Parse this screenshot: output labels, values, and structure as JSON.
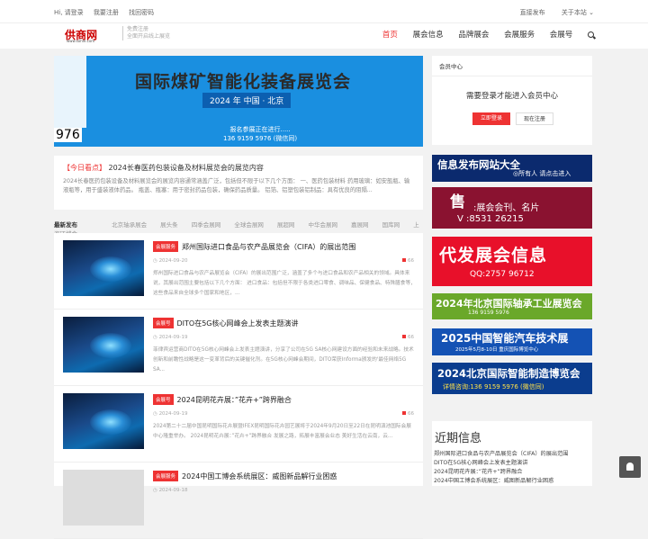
{
  "topbar": {
    "login": "Hi, 请登录",
    "register": "我要注册",
    "forgot": "找回密码",
    "publish": "直接发布",
    "about": "关于本站 ⌄"
  },
  "header": {
    "logo_text": "供商网",
    "logo_url_text": "www.sohle.com",
    "slogan1": "免费注册",
    "slogan2": "全面开启线上展览",
    "nav": [
      "首页",
      "展会信息",
      "品牌展会",
      "会展服务",
      "会展号"
    ]
  },
  "banner": {
    "title": "国际煤矿智能化装备展览会",
    "sub": "2024 年   中国 · 北京",
    "contact1": "报名参展正在进行.....",
    "contact2": "136 9159 5976 (微信同)",
    "corner": "976"
  },
  "today": {
    "tag": "【今日看点】",
    "title": "2024长春医药包装设备及材料展览会的展览内容",
    "desc": "2024长春医药包装设备及材料展览会的展览内容通常涵盖广泛，包括但不限于以下几个方面： 一、医药包装材料 药用玻璃：如安瓿瓶、输液瓶等，用于盛装液体药品。 瓶盖、瓶塞：用于密封药品包装，确保药品质量。 铝箔、铝塑包装铝制品：具有优良的阻隔..."
  },
  "tabs": [
    "最新发布",
    "北京轴承展会",
    "展头条",
    "四季会展网",
    "全球会展网",
    "展超网",
    "中华会展网",
    "嘉展网",
    "国库网",
    "上海环博会"
  ],
  "articles": [
    {
      "cat": "会展服务",
      "title": "郑州国际进口食品与农产品展览会（CIFA）的展出范围",
      "date": "2024-09-20",
      "views": "66",
      "desc": "郑州国际进口食品与农产品展览会（CIFA）的展出范围广泛，涵盖了多个与进口食品和农产品相关的领域。具体来说，其展出范围主要包括以下几个方面： 进口食品：包括但不限于各类进口零食、调味品、保健食品、特殊膳食等，这些食品来自全球多个国家和地区，..."
    },
    {
      "cat": "会展号",
      "title": "DITO在5G核心网峰会上发表主题演讲",
      "date": "2024-09-19",
      "views": "66",
      "desc": "菲律宾运营商DITO在5G核心网峰会上发表主题演讲，分享了公司在5G SA核心网建设方面的经验和未来战略。技术创新和前瞻性战略是这一变革背后的关键催化剂。在5G核心网峰会期间，DITO荣获Informa颁发的'最佳网络5G SA..."
    },
    {
      "cat": "会展号",
      "title": "2024昆明花卉展：”花卉+”跨界融合",
      "date": "2024-09-19",
      "views": "66",
      "desc": "2024第二十二届中国昆明国际花卉展暨IFEX昆明国际花卉园艺展将于2024年9月20日至22日在昆明滇池国际会展中心隆重举办。 2024昆明花卉展：”花卉+”跨界融合 发展之路，拓展丰富展会业态 美好生活在云南，云..."
    },
    {
      "cat": "会展服务",
      "title": "2024中国工博会系统展区：威图新品解行业困惑",
      "date": "2024-09-18",
      "views": "66",
      "desc": ""
    }
  ],
  "member": {
    "title": "会员中心",
    "msg": "需要登录才能进入会员中心",
    "login_btn": "立即登录",
    "register_btn": "现在注册"
  },
  "ads": {
    "ad1_a": "信息发布网站大全",
    "ad1_b": "◎所有人   请点击进入",
    "ad2_a": "售",
    "ad2_b": ":展会会刊、名片",
    "ad2_c": "V  :8531 26215",
    "ad3_a": "代发展会信息",
    "ad3_b": "QQ:2757 96712",
    "ad4_a": "2024年北京国际轴承工业展览会",
    "ad4_b": "136 9159 5976",
    "ad5_a": "2025中国智能汽车技术展",
    "ad5_b": "2025年5月8-10日    重庆国际博览中心",
    "ad6_a": "2024北京国际智能制造博览会",
    "ad6_b": "详情咨询:136 9159 5976 (微信同)"
  },
  "recent": {
    "title": "近期信息",
    "items": [
      "郑州国际进口食品与农产品展览会（CIFA）的展出范围",
      "DITO在5G核心网峰会上发表主题演讲",
      "2024昆明花卉展：”花卉+”跨界融合",
      "2024中国工博会系统展区：威图新品解行业困惑"
    ]
  },
  "colors": {
    "accent": "#e33333",
    "banner": "#1a8fe0"
  }
}
